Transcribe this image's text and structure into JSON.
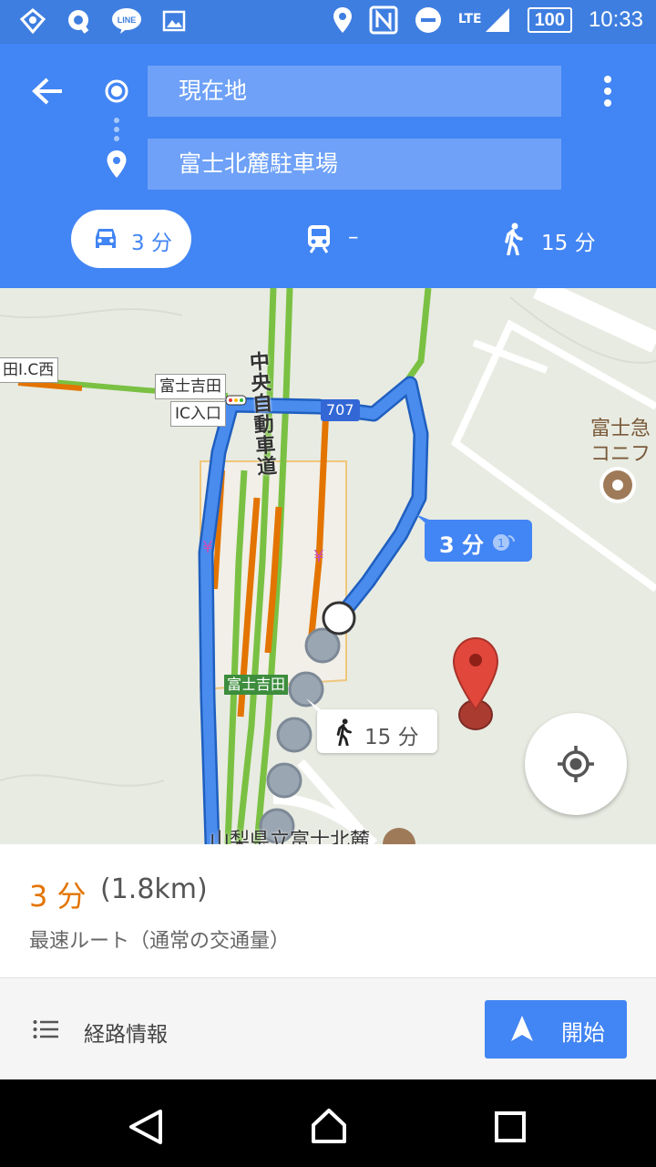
{
  "status_bar": {
    "lte": "LTE",
    "battery": "100",
    "time": "10:33",
    "icons": [
      "app-icon",
      "q-app-icon",
      "line-icon",
      "gallery-icon",
      "location-icon",
      "nfc-icon",
      "dnd-icon",
      "signal-icon",
      "battery-icon"
    ]
  },
  "directions": {
    "origin": "現在地",
    "destination": "富士北麓駐車場"
  },
  "modes": {
    "drive": "3 分",
    "transit": "–",
    "walk": "15 分"
  },
  "map": {
    "labels": {
      "ic_west": "田I.C西",
      "fujiyoshida_top": "富士吉田",
      "ic_entrance": "IC入口",
      "route_number": "707",
      "expressway": "中央自動車道",
      "poi_top_right_1": "富士急",
      "poi_top_right_2": "コニフ",
      "fujiyoshida_green": "富士吉田",
      "bottom_place": "山梨県立富士北麓"
    },
    "drive_callout": "3 分",
    "walk_callout": "15 分"
  },
  "summary": {
    "time": "3 分",
    "distance": "(1.8km)",
    "subtitle": "最速ルート（通常の交通量）"
  },
  "actions": {
    "steps": "経路情報",
    "start": "開始"
  },
  "colors": {
    "header": "#4285f4",
    "route": "#4a8bee",
    "traffic_green": "#7ac143",
    "traffic_orange": "#e37400",
    "pin": "#db4437"
  }
}
